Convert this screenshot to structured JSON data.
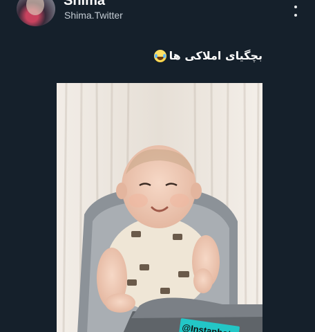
{
  "tweet": {
    "author_name": "Shima",
    "author_handle": "Shima.Twitter",
    "text": "بچگیای املاکی ها",
    "emoji_icon": "face-with-tears-of-joy-icon",
    "more_icon": "more-vertical-icon"
  },
  "media": {
    "watermark_text": "@Instaphoto"
  },
  "colors": {
    "background": "#15202b",
    "text_primary": "#ffffff",
    "text_secondary": "#c4ccd4",
    "watermark_bg": "#23c6c6"
  }
}
